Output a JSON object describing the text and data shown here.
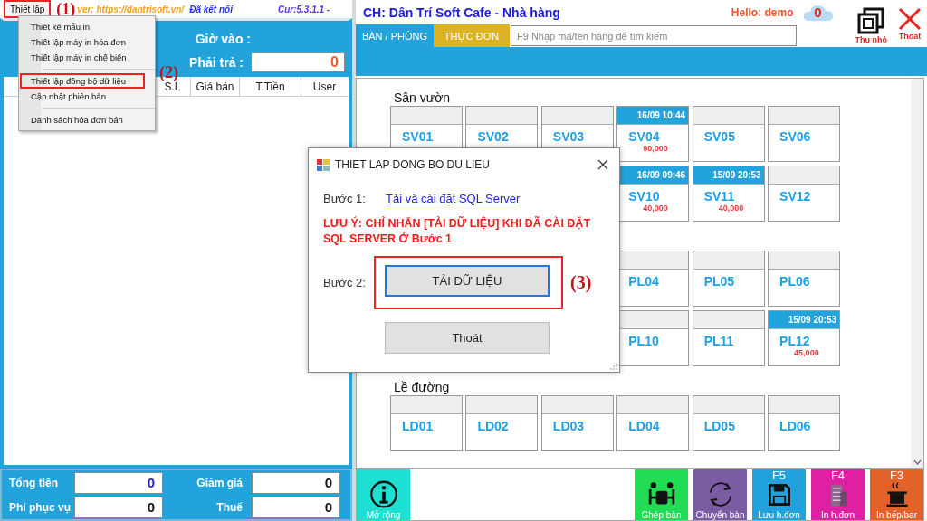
{
  "top_bar": {
    "menu_button": {
      "label": "Thiết lập",
      "highlighted": true
    },
    "menu_marker": "(1)",
    "server": "ver: https://dantrisoft.vn/",
    "connection": "Đã kết nối",
    "version": "Cur:5.3.1.1 -"
  },
  "menu": {
    "items": [
      {
        "label": "Thiết kế mẫu in",
        "highlighted": false,
        "separator_after": false
      },
      {
        "label": "Thiết lập máy in hóa đơn",
        "highlighted": false,
        "separator_after": false
      },
      {
        "label": "Thiết lập máy in chế biến",
        "highlighted": false,
        "separator_after": true
      },
      {
        "label": "Thiết lập đồng bộ dữ liệu",
        "highlighted": true,
        "separator_after": false
      },
      {
        "label": "Cập nhật phiên bản",
        "highlighted": false,
        "separator_after": true
      },
      {
        "label": "Danh sách hóa đơn bán",
        "highlighted": false,
        "separator_after": false
      }
    ],
    "marker": "(2)"
  },
  "order_panel": {
    "time_in_label": "Giờ vào :",
    "to_pay_label": "Phải trả :",
    "to_pay": "0",
    "columns": [
      "S.L",
      "Giá bán",
      "T.Tiền",
      "User"
    ]
  },
  "totals": [
    {
      "label": "Tổng tiền",
      "value": "0",
      "accent": true
    },
    {
      "label": "Giảm giá",
      "value": "0",
      "accent": false
    },
    {
      "label": "Phí phục vụ",
      "value": "0",
      "accent": false
    },
    {
      "label": "Thuế",
      "value": "0",
      "accent": false
    }
  ],
  "header": {
    "title": "CH: Dân Trí Soft Cafe - Nhà hàng",
    "greeting": "Hello: demo",
    "badge": "0",
    "minimize": "Thu nhỏ",
    "exit": "Thoát"
  },
  "tabs": [
    {
      "label": "BÀN / PHÒNG",
      "selected": true
    },
    {
      "label": "THỰC ĐƠN",
      "selected": false
    }
  ],
  "search": {
    "placeholder": "F9 Nhập mã/tên hàng để tìm kiếm"
  },
  "sections": [
    {
      "title": "Sân vườn",
      "rows": [
        [
          {
            "name": "SV01",
            "occupied": false
          },
          {
            "name": "SV02",
            "occupied": false
          },
          {
            "name": "SV03",
            "occupied": false
          },
          {
            "name": "SV04",
            "occupied": true,
            "time": "16/09 10:44",
            "amount": "90,000"
          },
          {
            "name": "SV05",
            "occupied": false
          },
          {
            "name": "SV06",
            "occupied": false
          }
        ],
        [
          "",
          "",
          "",
          {
            "name": "SV10",
            "occupied": true,
            "time": "16/09 09:46",
            "amount": "40,000"
          },
          {
            "name": "SV11",
            "occupied": true,
            "time": "15/09 20:53",
            "amount": "40,000"
          },
          {
            "name": "SV12",
            "occupied": false
          }
        ]
      ]
    },
    {
      "rows": [
        [
          "",
          "",
          "",
          {
            "name": "PL04",
            "occupied": false
          },
          {
            "name": "PL05",
            "occupied": false
          },
          {
            "name": "PL06",
            "occupied": false
          }
        ],
        [
          "",
          "",
          "",
          {
            "name": "PL10",
            "occupied": false
          },
          {
            "name": "PL11",
            "occupied": false
          },
          {
            "name": "PL12",
            "occupied": true,
            "time": "15/09 20:53",
            "amount": "45,000"
          }
        ]
      ]
    },
    {
      "title": "Lề đường",
      "rows": [
        [
          {
            "name": "LD01",
            "occupied": false
          },
          {
            "name": "LD02",
            "occupied": false
          },
          {
            "name": "LD03",
            "occupied": false
          },
          {
            "name": "LD04",
            "occupied": false
          },
          {
            "name": "LD05",
            "occupied": false
          },
          {
            "name": "LD06",
            "occupied": false
          }
        ]
      ]
    }
  ],
  "toolbar": [
    {
      "kind": "info",
      "label": "Mở rộng",
      "color": "#1ee0d2"
    },
    {
      "kind": "spacer"
    },
    {
      "kind": "merge",
      "label": "Ghép bàn",
      "color": "#22dc55"
    },
    {
      "kind": "move",
      "label": "Chuyển bàn",
      "color": "#7a5ca2"
    },
    {
      "kind": "save",
      "key": "F5",
      "label": "Lưu h.đơn",
      "color": "#22a2dc"
    },
    {
      "kind": "print",
      "key": "F4",
      "label": "In h.đơn",
      "color": "#e020a2"
    },
    {
      "kind": "kitchen",
      "key": "F3",
      "label": "In bếp/bar",
      "color": "#e2622a"
    }
  ],
  "dialog": {
    "title": "THIET LAP DONG BO DU LIEU",
    "step1_label": "Bước 1:",
    "step1_link": "Tải và cài đặt SQL Server",
    "warning": "LƯU Ý: CHỈ NHẤN [TẢI DỮ LIỆU] KHI ĐÃ CÀI ĐẶT SQL SERVER Ở Bước 1",
    "step2_label": "Bước 2:",
    "download_button": "TẢI DỮ LIỆU",
    "marker": "(3)",
    "exit_button": "Thoát"
  }
}
